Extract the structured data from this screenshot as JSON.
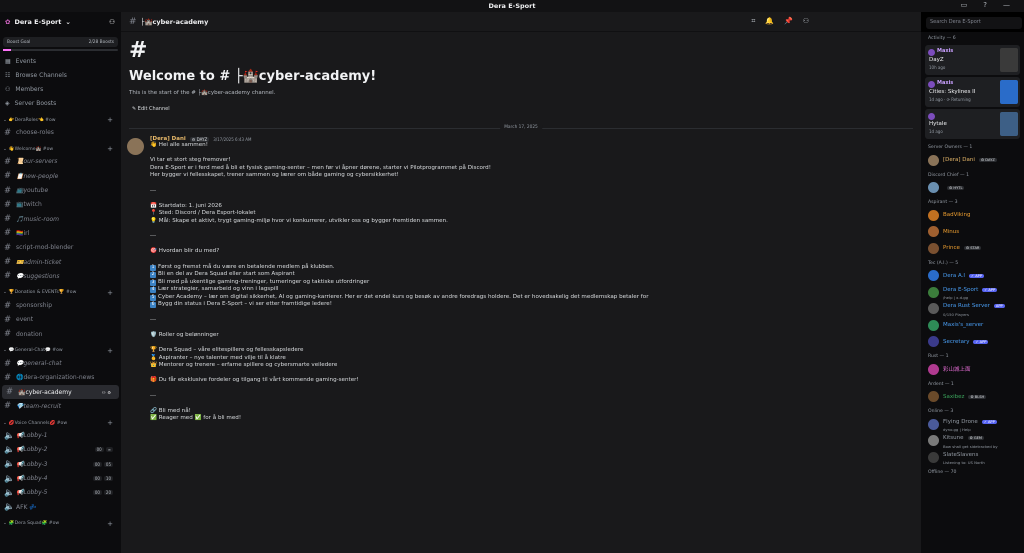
{
  "window": {
    "title": "Dera E-Sport"
  },
  "server": {
    "name": "Dera E-Sport",
    "boost_label": "Boost Goal",
    "boost_count": "2/28 Boosts",
    "boost_progress": 0.07
  },
  "nav": [
    {
      "label": "Events"
    },
    {
      "label": "Browse Channels"
    },
    {
      "label": "Members"
    },
    {
      "label": "Server Boosts"
    }
  ],
  "categories": [
    {
      "name": "👉DeraRoles👈 #ow",
      "channels": [
        {
          "name": "choose-roles",
          "italic": false
        }
      ]
    },
    {
      "name": "👋Welcome🏰 #ow",
      "channels": [
        {
          "name": "📜our-servers",
          "italic": true
        },
        {
          "name": "📋new-people",
          "italic": true
        },
        {
          "name": "📺youtube",
          "italic": true
        },
        {
          "name": "📺twitch",
          "italic": false
        },
        {
          "name": "🎵music-room",
          "italic": true
        },
        {
          "name": "🏳️‍🌈irl",
          "italic": false
        },
        {
          "name": "script-mod-blender",
          "italic": false
        },
        {
          "name": "🎫admin-ticket",
          "italic": true
        },
        {
          "name": "💬suggestions",
          "italic": true
        }
      ]
    },
    {
      "name": "🏆Donation & EVENTs🏆 #ow",
      "channels": [
        {
          "name": "sponsorship",
          "italic": false
        },
        {
          "name": "event",
          "italic": false
        },
        {
          "name": "donation",
          "italic": false
        }
      ]
    },
    {
      "name": "💬General-Chat💬 #ow",
      "channels": [
        {
          "name": "💬general-chat",
          "italic": true
        },
        {
          "name": "🌐dera-organization-news",
          "italic": false
        },
        {
          "name": "🏰cyber-academy",
          "italic": false,
          "active": true
        },
        {
          "name": "💎team-recruit",
          "italic": true
        }
      ]
    },
    {
      "name": "💋Voice Channels💋 #ow",
      "channels": [
        {
          "name": "📢Lobby-1",
          "italic": true,
          "badges": []
        },
        {
          "name": "📢Lobby-2",
          "italic": true,
          "badges": [
            "00",
            "∞"
          ]
        },
        {
          "name": "📢Lobby-3",
          "italic": true,
          "badges": [
            "00",
            "05"
          ]
        },
        {
          "name": "📢Lobby-4",
          "italic": true,
          "badges": [
            "00",
            "10"
          ]
        },
        {
          "name": "📢Lobby-5",
          "italic": true,
          "badges": [
            "00",
            "20"
          ]
        },
        {
          "name": "AFK 💤",
          "italic": false,
          "badges": []
        }
      ]
    },
    {
      "name": "🧩Dera Squad🧩 #ow",
      "channels": []
    }
  ],
  "channel": {
    "name": "cyber-academy",
    "header": "├🏰cyber-academy",
    "search_placeholder": "Search Dera E-Sport"
  },
  "welcome": {
    "hash": "#",
    "title": "Welcome to # ├🏰cyber-academy!",
    "sub": "This is the start of the # ├🏰cyber-academy channel.",
    "edit": "✎ Edit Channel"
  },
  "date_divider": "March 17, 2025",
  "message": {
    "author": "[Dera] Dani",
    "tag": "⚙ DAYZ",
    "time": "3/17/2025 6:43 AM",
    "lines": [
      "👋 Hei alle sammen!",
      "",
      "Vi tar et stort steg fremover!",
      "Dera E-Sport er i ferd med å bli et fysisk gaming-senter – men før vi åpner dørene, starter vi Pilotprogrammet på Discord!",
      "Her bygger vi fellesskapet, trener sammen og lærer om både gaming og cybersikkerhet!",
      "",
      "---",
      "",
      "📅 Startdato: 1. juni 2026",
      "📍 Sted: Discord / Dera Esport-lokalet",
      "💡 Mål: Skape et aktivt, trygt gaming-miljø hvor vi konkurrerer, utvikler oss og bygger fremtiden sammen.",
      "",
      "---",
      "",
      "🎯 Hvordan blir du med?",
      "",
      "1|Først og fremst må du være en betalende medlem på klubben.",
      "2|Bli en del av Dera Squad eller start som Aspirant",
      "3|Bli med på ukentlige gaming-treninger, turneringer og taktiske utfordringer",
      "4|Lær strategier, samarbeid og vinn i lagspill",
      "5|Cyber Academy – lær om digital sikkerhet, AI og gaming-karrierer. Her er det endel kurs og besøk av andre foredrags holdere. Det er hovedsakelig det medlemskap betaler for",
      "6|Bygg din status i Dera E-Sport – vi ser etter framtidige ledere!",
      "",
      "---",
      "",
      "🛡️ Roller og belønninger",
      "",
      "🏆 Dera Squad – våre elitespillere og fellesskapsledere",
      "🥇 Aspiranter – nye talenter med vilje til å klatre",
      "👑 Mentorer og trenere – erfarne spillere og cybersmarte veiledere",
      "",
      "🎁 Du får eksklusive fordeler og tilgang til vårt kommende gaming-senter!",
      "",
      "---",
      "",
      "🔗 Bli med nå!",
      "✅ Reager med ✅ for å bli med!"
    ]
  },
  "right": {
    "activity_header": "Activity — 6",
    "activities": [
      {
        "user": "Maxis",
        "game": "DayZ",
        "sub": "10h ago",
        "color": "#3a3a3a"
      },
      {
        "user": "Maxis",
        "game": "Cities: Skylines II",
        "sub": "1d ago · ⟳ Returning",
        "color": "#2a6cc9"
      },
      {
        "user": "",
        "game": "Hytale",
        "sub": "1d ago",
        "color": "#3d5f86"
      }
    ],
    "groups": [
      {
        "name": "Server Owners — 1",
        "members": [
          {
            "name": "[Dera] Dani",
            "color": "#e8b96a",
            "tag": "⚙ DAYZ",
            "av": "#8a7358"
          }
        ]
      },
      {
        "name": "Discord Chief — 1",
        "members": [
          {
            "name": "",
            "color": "#3c6fd8",
            "tag": "⚙ HYTL",
            "av": "#6a8fb0"
          }
        ]
      },
      {
        "name": "Aspirant — 3",
        "members": [
          {
            "name": "BadViking",
            "color": "#f0a030",
            "av": "#c07020"
          },
          {
            "name": "Minus",
            "color": "#f0a030",
            "av": "#a06030"
          },
          {
            "name": "Prince",
            "color": "#f0a030",
            "tag": "⚙ STAR",
            "av": "#7a5030"
          }
        ]
      },
      {
        "name": "Tec (A.I.) — 5",
        "members": [
          {
            "name": "Dera A.I",
            "color": "#4a9ff5",
            "app": "✓ APP",
            "av": "#2a6cc9"
          },
          {
            "name": "Dera E-Sport",
            "color": "#4a9ff5",
            "app": "✓ APP",
            "sub": "/help | x.d.gg",
            "av": "#3b7d3b"
          },
          {
            "name": "Dera Rust Server",
            "color": "#4a9ff5",
            "app": "APP",
            "sub": "0/150 Players",
            "av": "#5a5a5a"
          },
          {
            "name": "Maxis's_server",
            "color": "#4a9ff5",
            "av": "#2e8b57"
          },
          {
            "name": "Secretary",
            "color": "#4a9ff5",
            "app": "✓ APP",
            "av": "#3a3a8a"
          }
        ]
      },
      {
        "name": "Rust — 1",
        "members": [
          {
            "name": "彩山城上面",
            "color": "#e06bd0",
            "av": "#b03a90"
          }
        ]
      },
      {
        "name": "Ardent — 1",
        "members": [
          {
            "name": "Saxibez",
            "color": "#3ba55c",
            "tag": "⚙ BLSH",
            "av": "#6a4a2a"
          }
        ]
      },
      {
        "name": "Online — 3",
        "members": [
          {
            "name": "Flying Drone",
            "color": "#949ba4",
            "app": "✓ APP",
            "sub": "dyno.gg | Help",
            "av": "#4a5a9a"
          },
          {
            "name": "Kitsune",
            "color": "#949ba4",
            "tag": "⚙ GEM",
            "sub": "Bow shall get sidetracked by",
            "av": "#7a7a7a"
          },
          {
            "name": "SlateSlavens",
            "color": "#949ba4",
            "sub": "Listening to: US North",
            "av": "#3a3a3a"
          }
        ]
      },
      {
        "name": "Offline — 70",
        "members": []
      }
    ]
  },
  "colors": {
    "accent": "#5865f2",
    "bg_main": "#19191b",
    "bg_side": "#0c0c0e"
  }
}
